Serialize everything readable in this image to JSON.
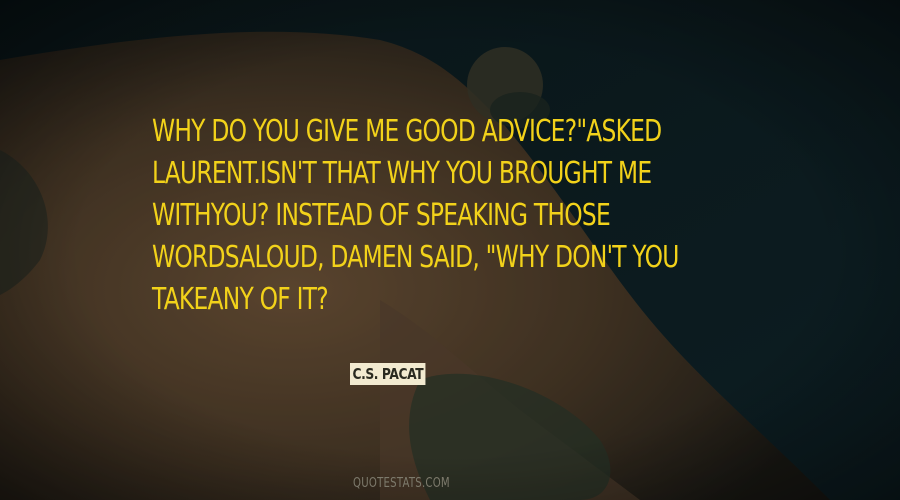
{
  "quote": {
    "lines": [
      "WHY DO YOU GIVE ME GOOD ADVICE?\"ASKED",
      "LAURENT.ISN'T THAT WHY YOU BROUGHT ME",
      "WITHYOU? INSTEAD OF SPEAKING THOSE",
      "WORDSALOUD, DAMEN SAID, \"WHY DON'T YOU",
      "TAKEANY OF IT?"
    ]
  },
  "author": "C.S. PACAT",
  "watermark": "QUOTESTATS.COM",
  "colors": {
    "quote_text": "#f2d21a",
    "author_text": "#2a2a20",
    "author_bg": "#f2ead0",
    "watermark_text": "#7d7a6c",
    "sea": "#0f2228",
    "sand": "#5a4630",
    "rock": "#2e3a30"
  }
}
